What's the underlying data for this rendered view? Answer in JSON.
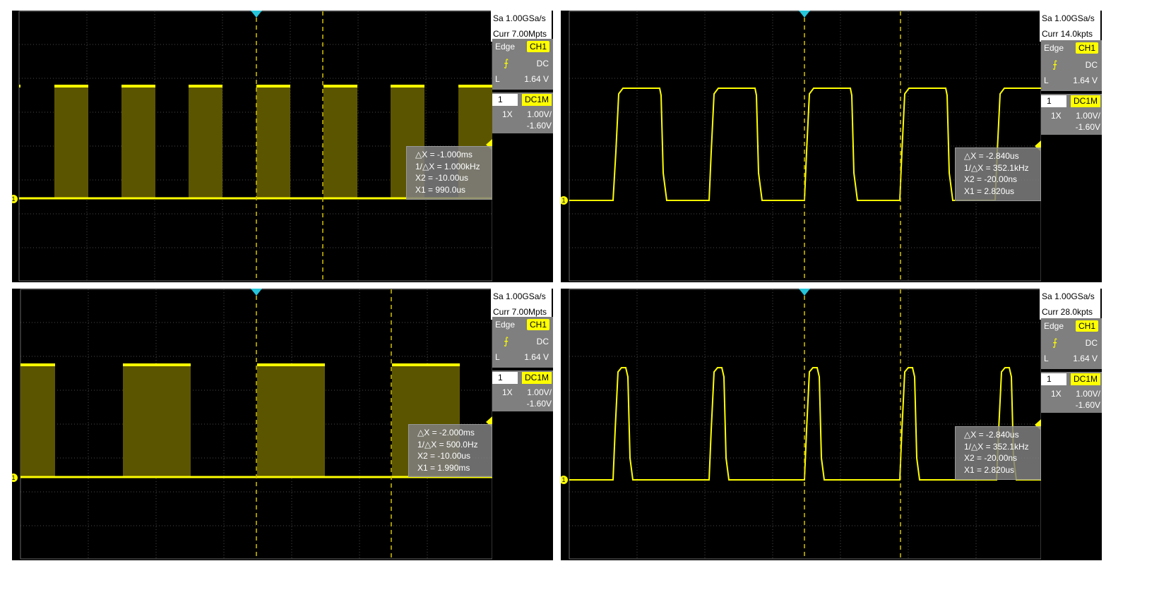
{
  "panels": [
    {
      "sample_rate": "Sa 1.00GSa/s",
      "memory_depth": "Curr 7.00Mpts",
      "trigger": {
        "mode": "Edge",
        "source": "CH1",
        "coupling": "DC",
        "level_label": "L",
        "level": "1.64 V"
      },
      "channel": {
        "number": "1",
        "coupling": "DC1M",
        "probe": "1X",
        "scale": "1.00V/",
        "offset": "-1.60V"
      },
      "cursor": {
        "delta_x": "△X = -1.000ms",
        "inv_delta_x": "1/△X = 1.000kHz",
        "x2": "X2 = -10.00us",
        "x1": "X1 = 990.0us"
      },
      "channel_marker": "1"
    },
    {
      "sample_rate": "Sa 1.00GSa/s",
      "memory_depth": "Curr 14.0kpts",
      "trigger": {
        "mode": "Edge",
        "source": "CH1",
        "coupling": "DC",
        "level_label": "L",
        "level": "1.64 V"
      },
      "channel": {
        "number": "1",
        "coupling": "DC1M",
        "probe": "1X",
        "scale": "1.00V/",
        "offset": "-1.60V"
      },
      "cursor": {
        "delta_x": "△X = -2.840us",
        "inv_delta_x": "1/△X = 352.1kHz",
        "x2": "X2 = -20.00ns",
        "x1": "X1 = 2.820us"
      },
      "channel_marker": "1"
    },
    {
      "sample_rate": "Sa 1.00GSa/s",
      "memory_depth": "Curr 7.00Mpts",
      "trigger": {
        "mode": "Edge",
        "source": "CH1",
        "coupling": "DC",
        "level_label": "L",
        "level": "1.64 V"
      },
      "channel": {
        "number": "1",
        "coupling": "DC1M",
        "probe": "1X",
        "scale": "1.00V/",
        "offset": "-1.60V"
      },
      "cursor": {
        "delta_x": "△X = -2.000ms",
        "inv_delta_x": "1/△X = 500.0Hz",
        "x2": "X2 = -10.00us",
        "x1": "X1 = 1.990ms"
      },
      "channel_marker": "1"
    },
    {
      "sample_rate": "Sa 1.00GSa/s",
      "memory_depth": "Curr 28.0kpts",
      "trigger": {
        "mode": "Edge",
        "source": "CH1",
        "coupling": "DC",
        "level_label": "L",
        "level": "1.64 V"
      },
      "channel": {
        "number": "1",
        "coupling": "DC1M",
        "probe": "1X",
        "scale": "1.00V/",
        "offset": "-1.60V"
      },
      "cursor": {
        "delta_x": "△X = -2.840us",
        "inv_delta_x": "1/△X = 352.1kHz",
        "x2": "X2 = -20.00ns",
        "x1": "X1 = 2.820us"
      },
      "channel_marker": "1"
    }
  ],
  "colors": {
    "trace": "#ffff00",
    "fill": "#5c5500",
    "grid": "#4a4a4a",
    "cursor": "#d4c200",
    "trigger_marker": "#26c6da"
  }
}
